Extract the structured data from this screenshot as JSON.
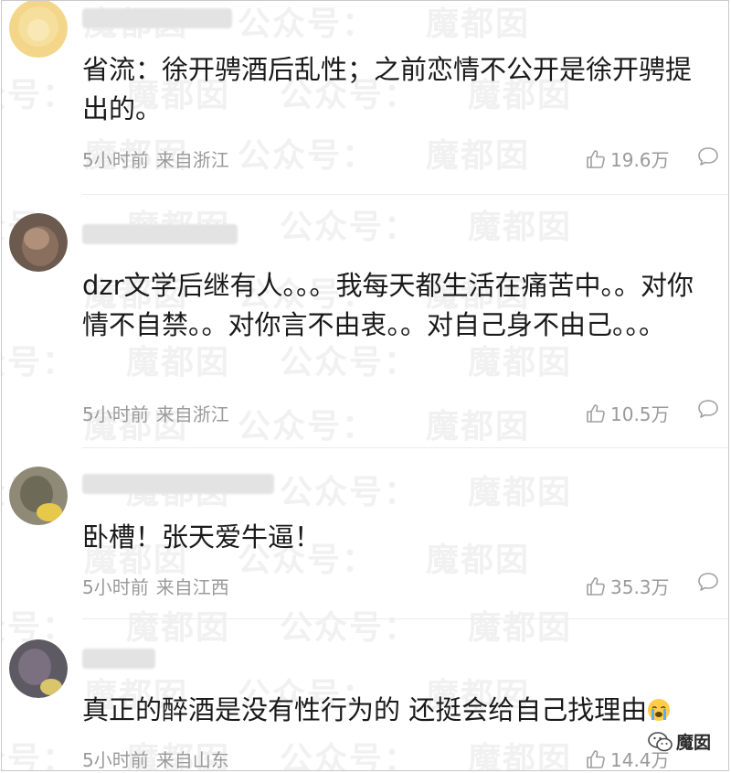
{
  "watermark": {
    "text_primary": "魔都囡",
    "text_secondary": "公众号："
  },
  "comments": [
    {
      "text": "省流：徐开骋酒后乱性；之前恋情不公开是徐开骋提出的。",
      "time": "5小时前",
      "location": "来自浙江",
      "likes": "19.6万"
    },
    {
      "text": "dzr文学后继有人。。。我每天都生活在痛苦中。。对你情不自禁。。对你言不由衷。。对自己身不由己。。。",
      "time": "5小时前",
      "location": "来自浙江",
      "likes": "10.5万"
    },
    {
      "text": "卧槽！张天爱牛逼！",
      "time": "5小时前",
      "location": "来自江西",
      "likes": "35.3万"
    },
    {
      "text": "真正的醉酒是没有性行为的 还挺会给自己找理由",
      "time": "5小时前",
      "location": "来自山东",
      "likes": "14.4万"
    }
  ],
  "brand": {
    "label": "魔囡"
  },
  "icons": {
    "like": "thumbs-up-icon",
    "reply": "speech-bubble-icon",
    "emoji": "crying-face-emoji"
  },
  "colors": {
    "text": "#1a1a1a",
    "meta": "#9a9a9a",
    "divider": "#ececec",
    "watermark": "#f1f1f1"
  }
}
